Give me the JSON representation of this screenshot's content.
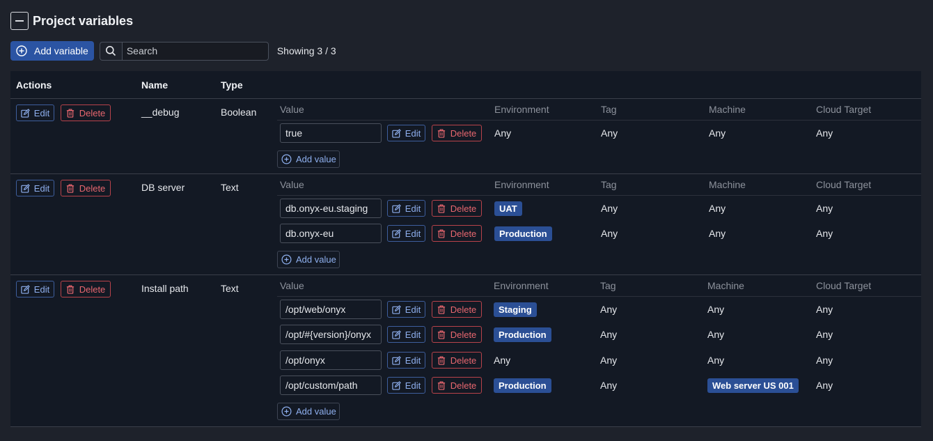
{
  "header": {
    "title": "Project variables"
  },
  "toolbar": {
    "add_variable_label": "Add variable",
    "search_placeholder": "Search",
    "showing": "Showing 3 / 3"
  },
  "table": {
    "columns": {
      "actions": "Actions",
      "name": "Name",
      "type": "Type"
    },
    "sub_columns": {
      "value": "Value",
      "environment": "Environment",
      "tag": "Tag",
      "machine": "Machine",
      "cloud_target": "Cloud Target"
    },
    "edit_label": "Edit",
    "delete_label": "Delete",
    "add_value_label": "Add value"
  },
  "variables": [
    {
      "name": "__debug",
      "type": "Boolean",
      "values": [
        {
          "value": "true",
          "environment": "Any",
          "tag": "Any",
          "machine": "Any",
          "cloud_target": "Any"
        }
      ]
    },
    {
      "name": "DB server",
      "type": "Text",
      "values": [
        {
          "value": "db.onyx-eu.staging",
          "environment": "UAT",
          "tag": "Any",
          "machine": "Any",
          "cloud_target": "Any"
        },
        {
          "value": "db.onyx-eu",
          "environment": "Production",
          "tag": "Any",
          "machine": "Any",
          "cloud_target": "Any"
        }
      ]
    },
    {
      "name": "Install path",
      "type": "Text",
      "values": [
        {
          "value": "/opt/web/onyx",
          "environment": "Staging",
          "tag": "Any",
          "machine": "Any",
          "cloud_target": "Any"
        },
        {
          "value": "/opt/#{version}/onyx",
          "environment": "Production",
          "tag": "Any",
          "machine": "Any",
          "cloud_target": "Any"
        },
        {
          "value": "/opt/onyx",
          "environment": "Any",
          "tag": "Any",
          "machine": "Any",
          "cloud_target": "Any"
        },
        {
          "value": "/opt/custom/path",
          "environment": "Production",
          "tag": "Any",
          "machine": "Web server US 001",
          "cloud_target": "Any"
        }
      ]
    }
  ],
  "colors": {
    "accent": "#2b54a3",
    "badge": "#2b4f95",
    "danger": "#e8676f",
    "link": "#8fb0ef"
  }
}
